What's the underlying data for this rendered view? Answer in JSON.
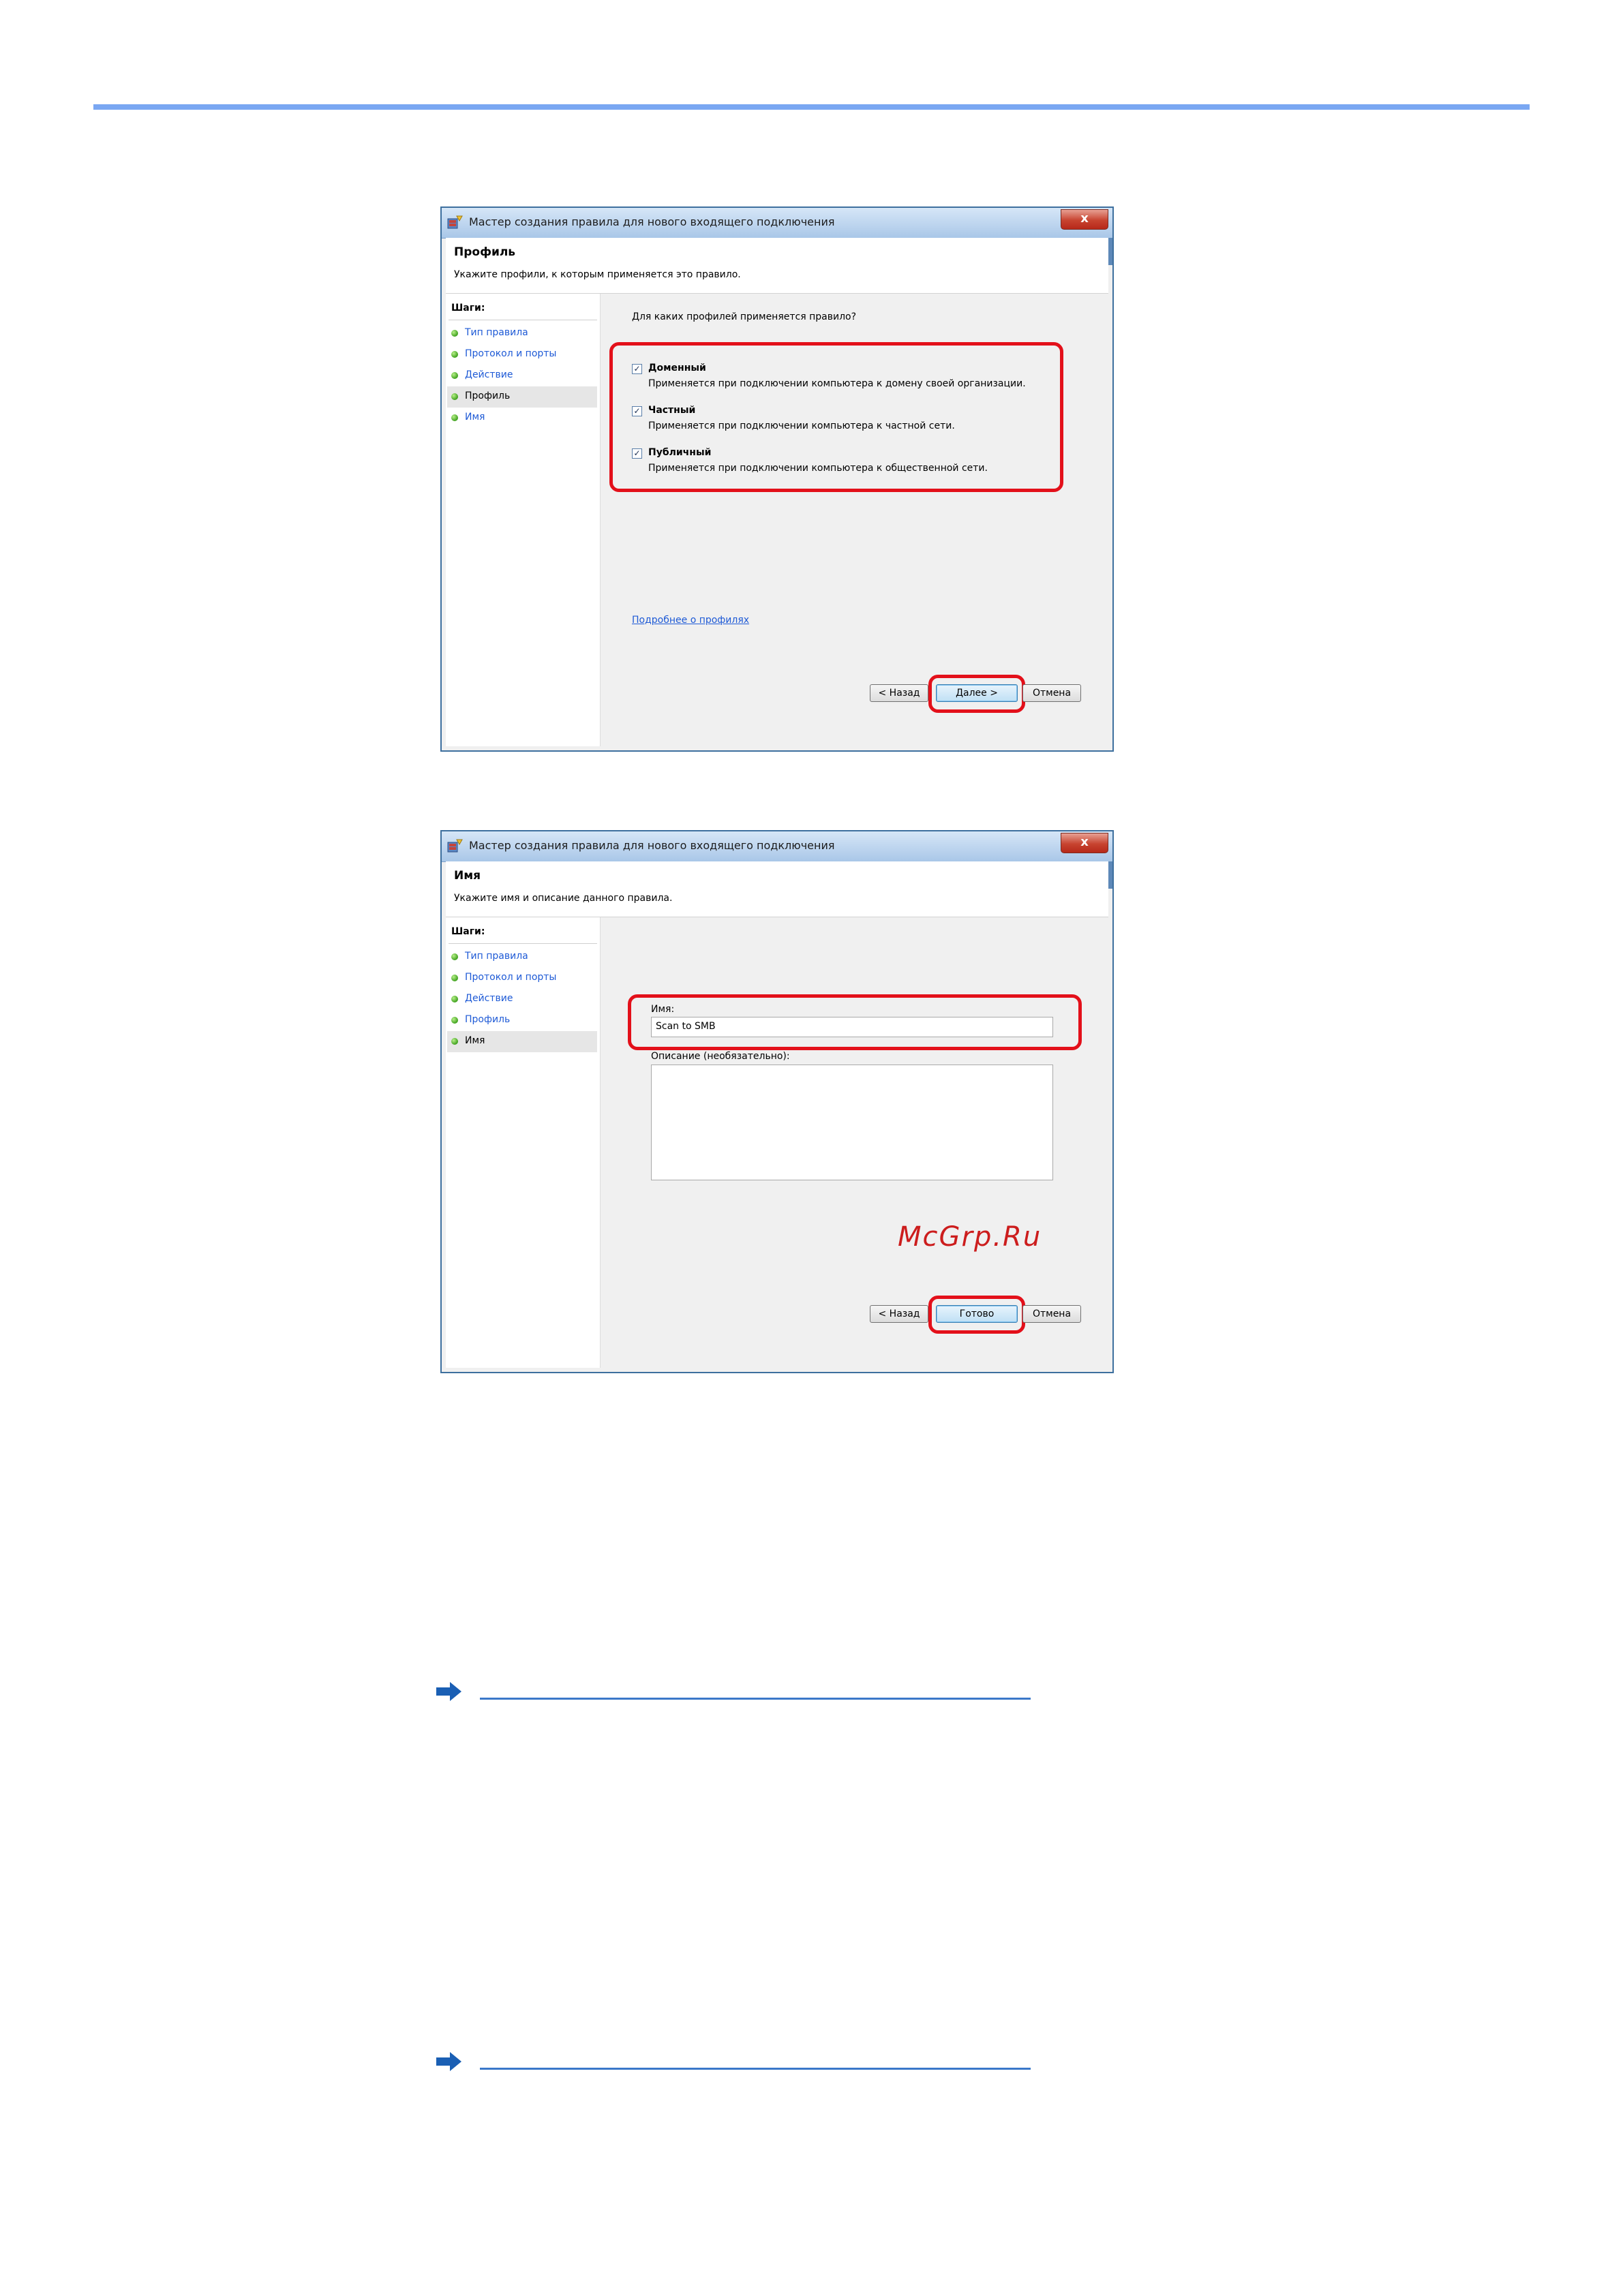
{
  "dialog_profile": {
    "window_title": "Мастер создания правила для нового входящего подключения",
    "close_label": "x",
    "header_title": "Профиль",
    "header_subtitle": "Укажите профили, к которым применяется это правило.",
    "steps_heading": "Шаги:",
    "steps": [
      {
        "label": "Тип правила",
        "active": false
      },
      {
        "label": "Протокол и порты",
        "active": false
      },
      {
        "label": "Действие",
        "active": false
      },
      {
        "label": "Профиль",
        "active": true
      },
      {
        "label": "Имя",
        "active": false
      }
    ],
    "question": "Для каких профилей применяется правило?",
    "profiles": [
      {
        "checked": true,
        "label": "Доменный",
        "description": "Применяется при подключении компьютера к домену своей организации."
      },
      {
        "checked": true,
        "label": "Частный",
        "description": "Применяется при подключении компьютера к частной сети."
      },
      {
        "checked": true,
        "label": "Публичный",
        "description": "Применяется при подключении компьютера к общественной сети."
      }
    ],
    "more_link": "Подробнее о профилях",
    "buttons": {
      "back": "< Назад",
      "next": "Далее >",
      "cancel": "Отмена"
    }
  },
  "dialog_name": {
    "window_title": "Мастер создания правила для нового входящего подключения",
    "close_label": "x",
    "header_title": "Имя",
    "header_subtitle": "Укажите имя и описание данного правила.",
    "steps_heading": "Шаги:",
    "steps": [
      {
        "label": "Тип правила",
        "active": false
      },
      {
        "label": "Протокол и порты",
        "active": false
      },
      {
        "label": "Действие",
        "active": false
      },
      {
        "label": "Профиль",
        "active": false
      },
      {
        "label": "Имя",
        "active": true
      }
    ],
    "name_label": "Имя:",
    "name_value": "Scan to SMB",
    "description_label": "Описание (необязательно):",
    "description_value": "",
    "watermark": "McGrp.Ru",
    "buttons": {
      "back": "< Назад",
      "finish": "Готово",
      "cancel": "Отмена"
    }
  },
  "colors": {
    "top_rule": "#7aa7f2",
    "highlight": "#e3101a",
    "link": "#1e5ad6",
    "arrow": "#1a5fb4"
  },
  "icons": {
    "title_icon": "firewall-wizard-icon",
    "step_icon": "green-dot-icon",
    "checkbox": "checkmark-icon",
    "arrow": "arrow-right-icon"
  }
}
